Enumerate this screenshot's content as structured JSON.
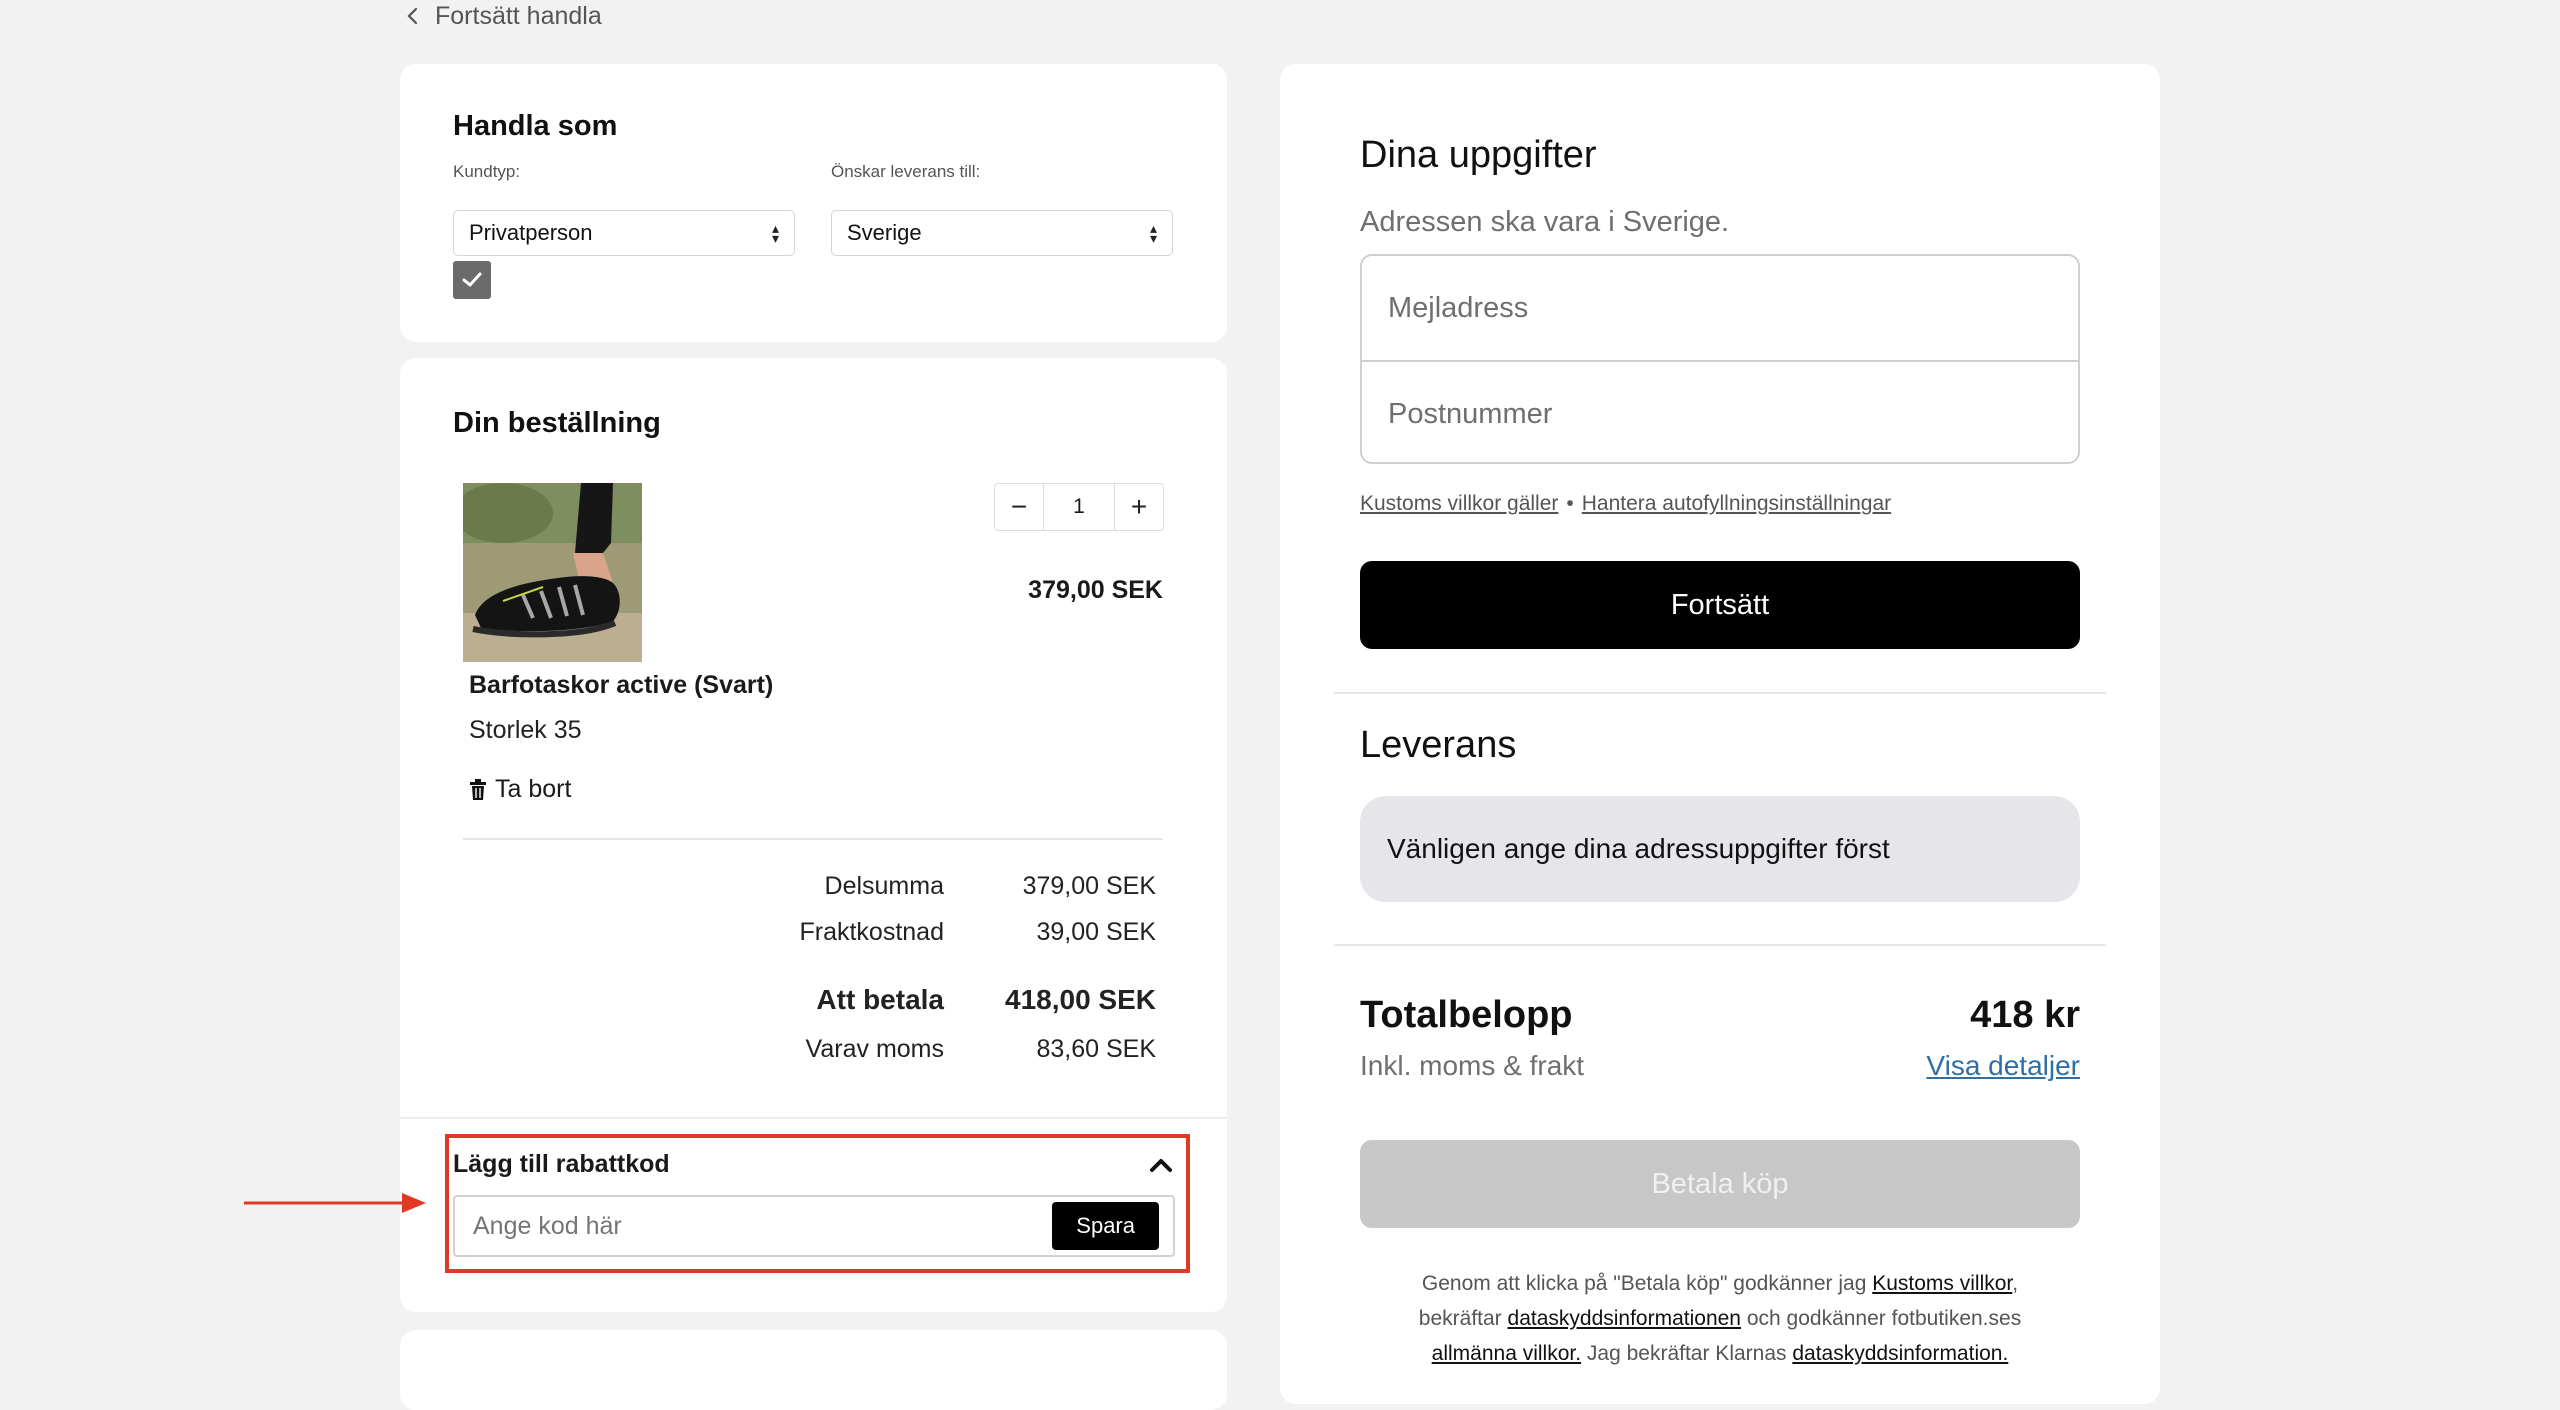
{
  "nav": {
    "back_label": "Fortsätt handla"
  },
  "shop_as": {
    "title": "Handla som",
    "customer_type_label": "Kundtyp:",
    "customer_type_value": "Privatperson",
    "delivery_label": "Önskar leverans till:",
    "delivery_value": "Sverige"
  },
  "order": {
    "title": "Din beställning",
    "item": {
      "name": "Barfotaskor active (Svart)",
      "size": "Storlek 35",
      "remove_label": "Ta bort",
      "quantity": "1",
      "price": "379,00 SEK"
    },
    "summary": {
      "subtotal_label": "Delsumma",
      "subtotal_value": "379,00 SEK",
      "shipping_label": "Fraktkostnad",
      "shipping_value": "39,00 SEK",
      "total_label": "Att betala",
      "total_value": "418,00 SEK",
      "vat_label": "Varav moms",
      "vat_value": "83,60 SEK"
    }
  },
  "discount": {
    "title": "Lägg till rabattkod",
    "placeholder": "Ange kod här",
    "save_label": "Spara"
  },
  "checkout": {
    "title": "Dina uppgifter",
    "subtitle": "Adressen ska vara i Sverige.",
    "email_placeholder": "Mejladress",
    "postal_placeholder": "Postnummer",
    "terms_link": "Kustoms villkor gäller",
    "separator": "•",
    "autofill_link": "Hantera autofyllningsinställningar",
    "continue_label": "Fortsätt"
  },
  "delivery": {
    "title": "Leverans",
    "notice": "Vänligen ange dina adressuppgifter först"
  },
  "total": {
    "label": "Totalbelopp",
    "amount": "418 kr",
    "sub": "Inkl. moms & frakt",
    "details_link": "Visa detaljer",
    "pay_label": "Betala köp"
  },
  "legal": {
    "t1": "Genom att klicka på \"Betala köp\" godkänner jag ",
    "l1": "Kustoms villkor",
    "t2": ",",
    "t3": "bekräftar ",
    "l2": "dataskyddsinformationen",
    "t4": " och godkänner fotbutiken.ses",
    "l3": "allmänna villkor.",
    "t5": " Jag bekräftar Klarnas ",
    "l4": "dataskyddsinformation."
  },
  "colors": {
    "highlight": "#e03a24",
    "link_blue": "#2f6fa5",
    "button_black": "#000000",
    "button_disabled": "#c7c7c7",
    "notice_bg": "#e6e6ea"
  }
}
